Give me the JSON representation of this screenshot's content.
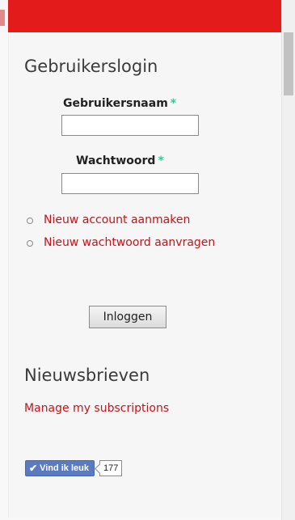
{
  "login_block": {
    "title": "Gebruikerslogin",
    "username_label": "Gebruikersnaam",
    "password_label": "Wachtwoord",
    "required_marker": "*",
    "username_value": "",
    "password_value": "",
    "links": [
      "Nieuw account aanmaken",
      "Nieuw wachtwoord aanvragen"
    ],
    "submit_label": "Inloggen"
  },
  "newsletter_block": {
    "title": "Nieuwsbrieven",
    "manage_link": "Manage my subscriptions"
  },
  "facebook": {
    "like_label": "Vind ik leuk",
    "like_count": "177"
  },
  "colors": {
    "header_red": "#e31b1b",
    "link_red": "#c0151b",
    "required_green": "#2ecc9a",
    "fb_blue": "#5b7bc0"
  },
  "icons": {
    "fb_check": "check-icon",
    "list_bullet": "circle-bullet-icon"
  }
}
